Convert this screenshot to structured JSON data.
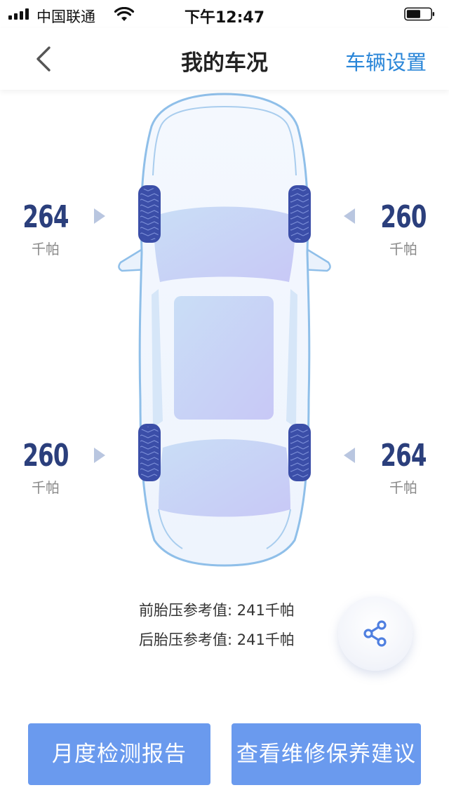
{
  "status_bar": {
    "carrier": "中国联通",
    "time": "下午12:47"
  },
  "nav": {
    "title": "我的车况",
    "action_label": "车辆设置"
  },
  "tires": {
    "front_left": {
      "value": "264",
      "unit": "千帕"
    },
    "front_right": {
      "value": "260",
      "unit": "千帕"
    },
    "rear_left": {
      "value": "260",
      "unit": "千帕"
    },
    "rear_right": {
      "value": "264",
      "unit": "千帕"
    }
  },
  "reference": {
    "front": "前胎压参考值: 241千帕",
    "rear": "后胎压参考值: 241千帕"
  },
  "buttons": {
    "monthly_report": "月度检测报告",
    "maintenance_advice": "查看维修保养建议"
  },
  "colors": {
    "accent": "#2a86d8",
    "value_text": "#2b3f7c",
    "button_bg": "#6a9aee",
    "tire": "#3b4ea8"
  }
}
